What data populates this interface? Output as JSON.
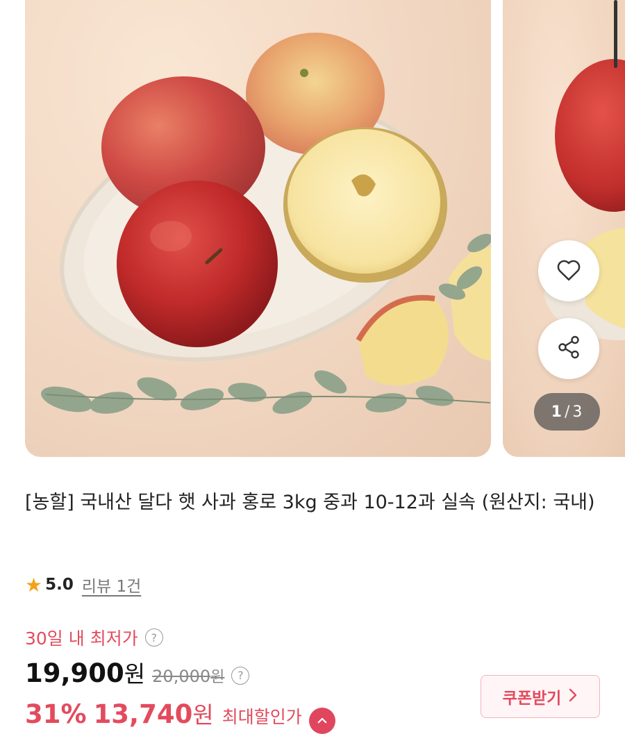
{
  "gallery": {
    "current": "1",
    "separator": "/",
    "total": "3",
    "icons": {
      "wishlist": "heart-icon",
      "share": "share-icon"
    }
  },
  "product": {
    "title": "[농할] 국내산 달다 햇 사과 홍로 3kg 중과 10-12과 실속 (원산지: 국내)",
    "rating": {
      "score": "5.0",
      "review_link": "리뷰 1건"
    },
    "lowest_label": "30일 내 최저가",
    "price": {
      "sale": "19,900",
      "unit": "원",
      "original": "20,000",
      "original_unit": "원"
    },
    "discount": {
      "percent": "31%",
      "price": "13,740",
      "unit": "원",
      "label": "최대할인가"
    },
    "coupon_button": "쿠폰받기"
  },
  "colors": {
    "accent": "#e34b5d",
    "star": "#f2a31b"
  }
}
